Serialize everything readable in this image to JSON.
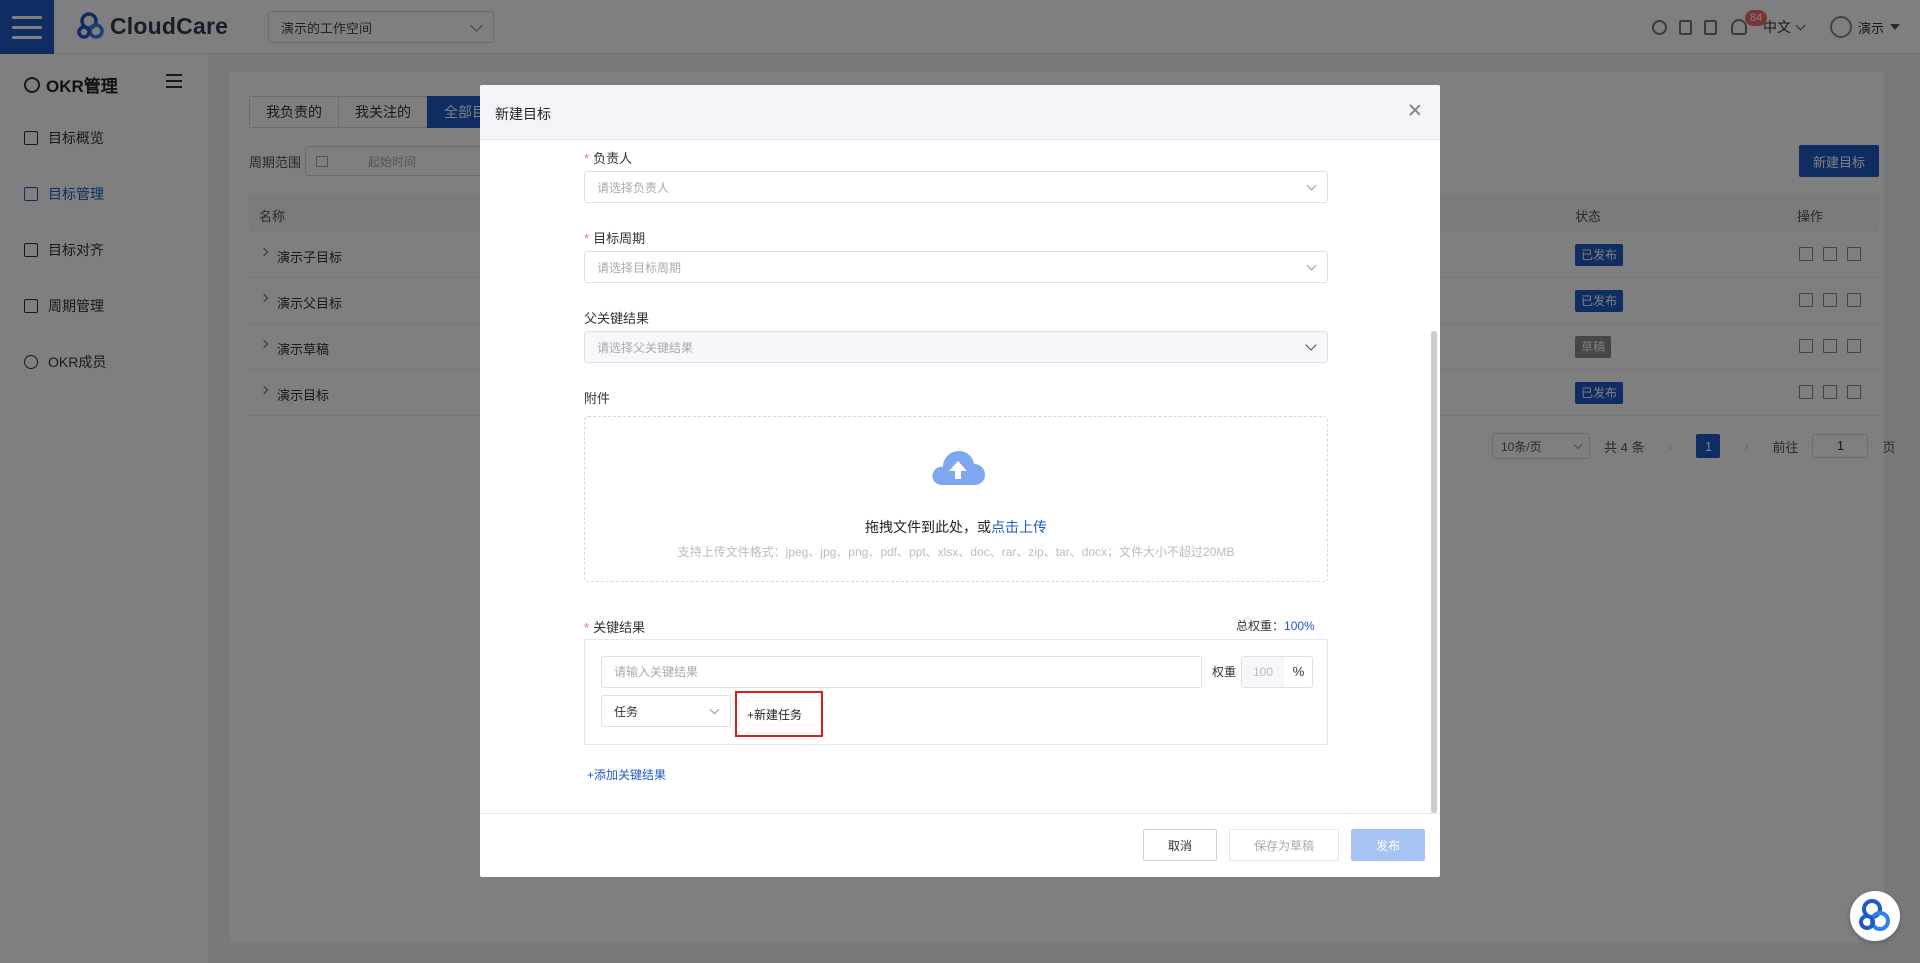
{
  "topbar": {
    "logo_text": "CloudCare",
    "workspace": "演示的工作空间",
    "notification_count": "84",
    "language": "中文",
    "user_name": "演示"
  },
  "sidebar": {
    "title": "OKR管理",
    "items": [
      {
        "label": "目标概览",
        "icon": "overview-icon",
        "active": false
      },
      {
        "label": "目标管理",
        "icon": "list-icon",
        "active": true
      },
      {
        "label": "目标对齐",
        "icon": "align-icon",
        "active": false
      },
      {
        "label": "周期管理",
        "icon": "calendar-icon",
        "active": false
      },
      {
        "label": "OKR成员",
        "icon": "user-icon",
        "active": false
      }
    ]
  },
  "main": {
    "tabs": [
      "我负责的",
      "我关注的",
      "全部目"
    ],
    "filter_label": "周期范围",
    "date_placeholder": "起始时间",
    "new_target_label": "新建目标",
    "columns": {
      "name": "名称",
      "status": "状态",
      "actions": "操作"
    },
    "rows": [
      {
        "name": "演示子目标",
        "status": "已发布",
        "status_color": "#1f5ac7"
      },
      {
        "name": "演示父目标",
        "status": "已发布",
        "status_color": "#1f5ac7"
      },
      {
        "name": "演示草稿",
        "status": "草稿",
        "status_color": "#8c8c8c"
      },
      {
        "name": "演示目标",
        "status": "已发布",
        "status_color": "#1f5ac7"
      }
    ],
    "pagination": {
      "page_size": "10条/页",
      "total": "共 4 条",
      "current_page": "1",
      "jump_label": "前往",
      "jump_value": "1",
      "page_suffix": "页"
    }
  },
  "modal": {
    "title": "新建目标",
    "owner_label": "负责人",
    "owner_placeholder": "请选择负责人",
    "period_label": "目标周期",
    "period_placeholder": "请选择目标周期",
    "parent_kr_label": "父关键结果",
    "parent_kr_placeholder": "请选择父关键结果",
    "attachment_label": "附件",
    "upload_text": "拖拽文件到此处，或",
    "upload_link": "点击上传",
    "upload_tip": "支持上传文件格式：jpeg、jpg、png、pdf、ppt、xlsx、doc、rar、zip、tar、docx；文件大小不超过20MB",
    "kr_label": "关键结果",
    "total_weight_label": "总权重：",
    "total_weight_value": "100%",
    "kr_placeholder": "请输入关键结果",
    "weight_label": "权重",
    "weight_value": "100",
    "weight_unit": "%",
    "task_type": "任务",
    "new_task_label": "+新建任务",
    "add_kr_label": "+添加关键结果",
    "cancel_label": "取消",
    "draft_label": "保存为草稿",
    "publish_label": "发布"
  },
  "colors": {
    "primary": "#1f5ac7",
    "highlight_box": "#e01b1b",
    "required": "#f56c6c"
  }
}
